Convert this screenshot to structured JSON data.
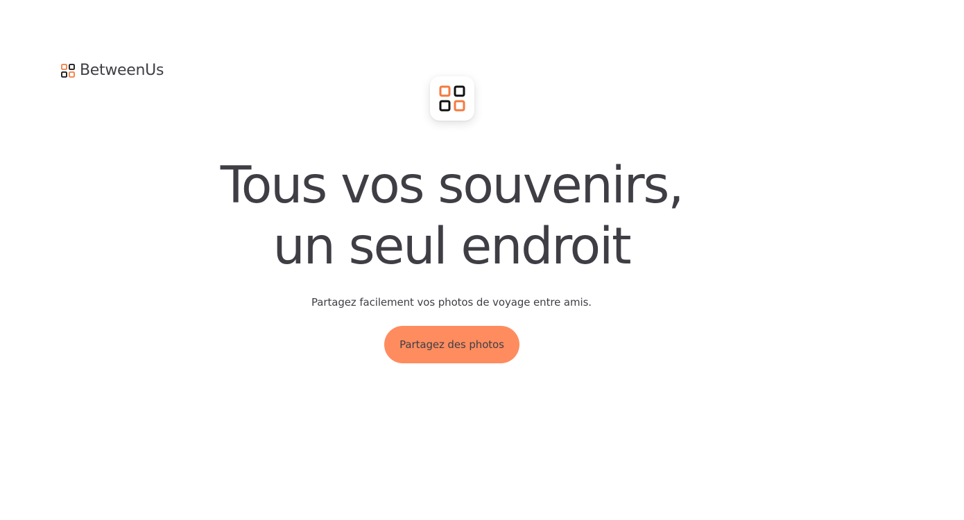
{
  "header": {
    "brand_name": "BetweenUs",
    "logo_icon": "grid-squares-icon"
  },
  "app_tile": {
    "icon": "grid-squares-icon"
  },
  "hero": {
    "title_line_1": "Tous vos souvenirs,",
    "title_line_2": "un seul endroit",
    "subtitle": "Partagez facilement vos photos de voyage entre amis.",
    "cta_label": "Partagez des photos"
  },
  "colors": {
    "accent": "#fe8c5f",
    "logo_orange": "#f47a3f",
    "logo_dark": "#111111",
    "text": "#3f3e45",
    "background": "#ffffff"
  }
}
